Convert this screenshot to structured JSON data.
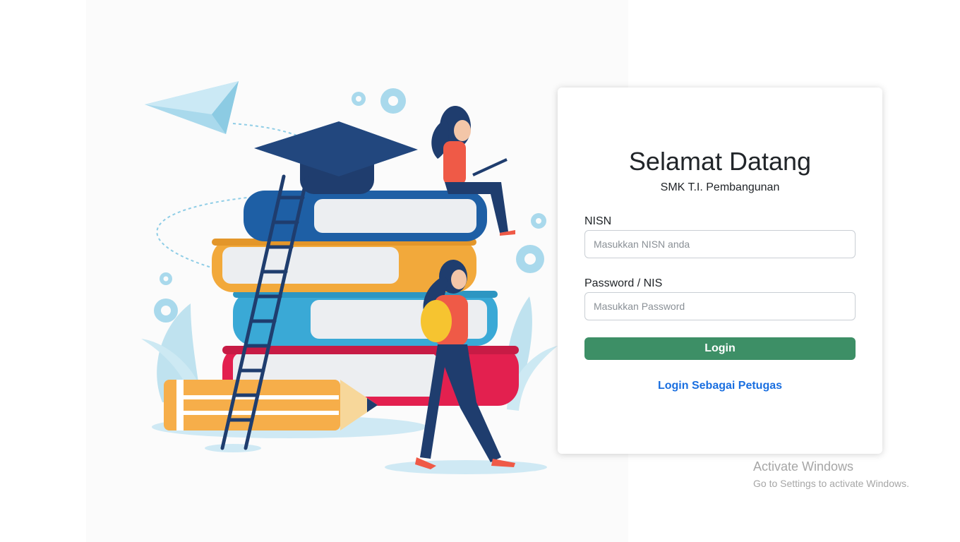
{
  "login": {
    "title": "Selamat Datang",
    "subtitle": "SMK T.I. Pembangunan",
    "nisn_label": "NISN",
    "nisn_placeholder": "Masukkan NISN anda",
    "nisn_value": "",
    "password_label": "Password / NIS",
    "password_placeholder": "Masukkan Password",
    "password_value": "",
    "login_button": "Login",
    "petugas_link": "Login Sebagai Petugas"
  },
  "watermark": {
    "title": "Activate Windows",
    "subtitle": "Go to Settings to activate Windows."
  },
  "colors": {
    "button": "#3d8f66",
    "link": "#1a6fe0",
    "book_blue": "#1e5fa5",
    "book_orange": "#f2a93b",
    "book_cyan": "#3aa9d6",
    "book_red": "#e3204f",
    "cap": "#1f3d6e"
  },
  "icons": [
    "paper-plane-icon",
    "gear-icon",
    "graduation-cap-icon",
    "ladder-icon",
    "pencil-icon"
  ]
}
